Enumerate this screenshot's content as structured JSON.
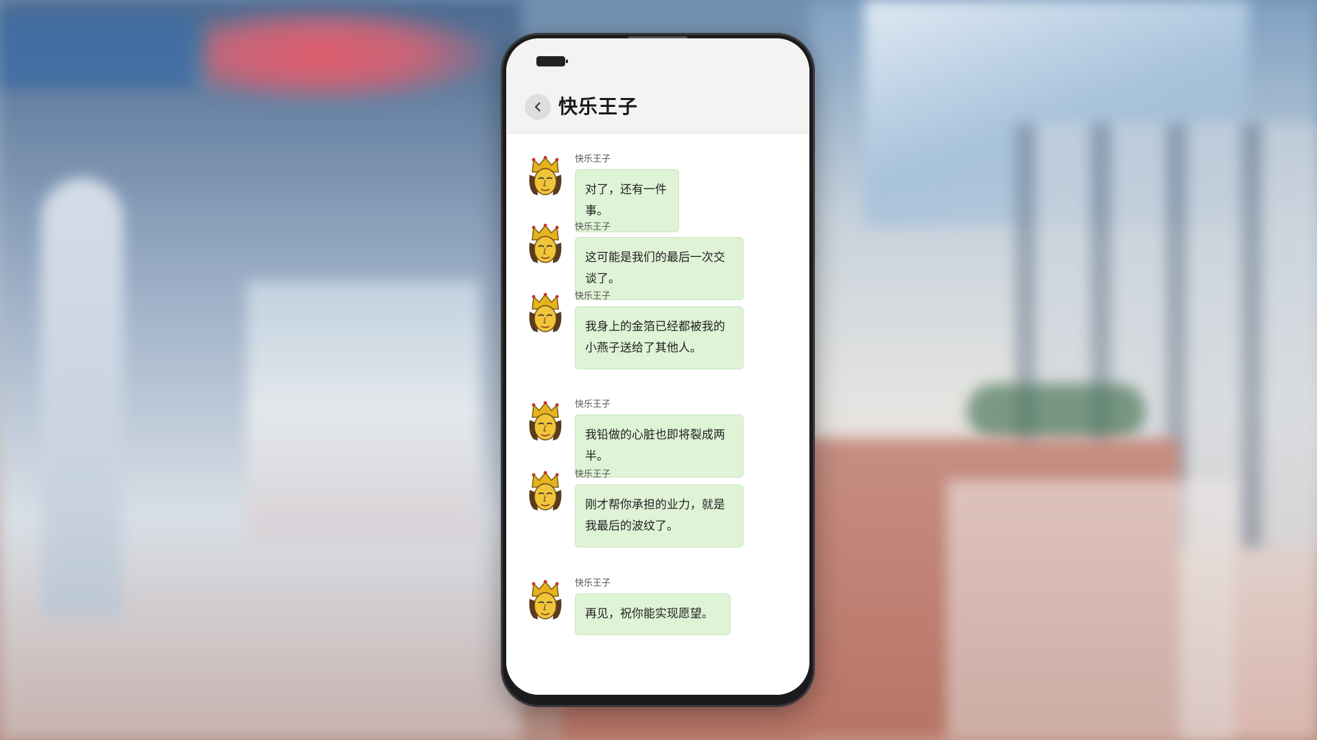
{
  "chat": {
    "title": "快乐王子",
    "messages": [
      {
        "sender": "快乐王子",
        "text": "对了，还有一件事。"
      },
      {
        "sender": "快乐王子",
        "text": "这可能是我们的最后一次交谈了。"
      },
      {
        "sender": "快乐王子",
        "text": "我身上的金箔已经都被我的小燕子送给了其他人。"
      },
      {
        "sender": "快乐王子",
        "text": "我铅做的心脏也即将裂成两半。"
      },
      {
        "sender": "快乐王子",
        "text": "刚才帮你承担的业力，就是我最后的波纹了。"
      },
      {
        "sender": "快乐王子",
        "text": "再见，祝你能实现愿望。"
      }
    ]
  },
  "icons": {
    "back": "chevron-left-icon",
    "battery": "battery-icon",
    "avatar": "crowned-prince-avatar"
  },
  "colors": {
    "bubble": "#dff3d6",
    "header": "#f3f3f3",
    "avatar_gold": "#e6b21f"
  }
}
